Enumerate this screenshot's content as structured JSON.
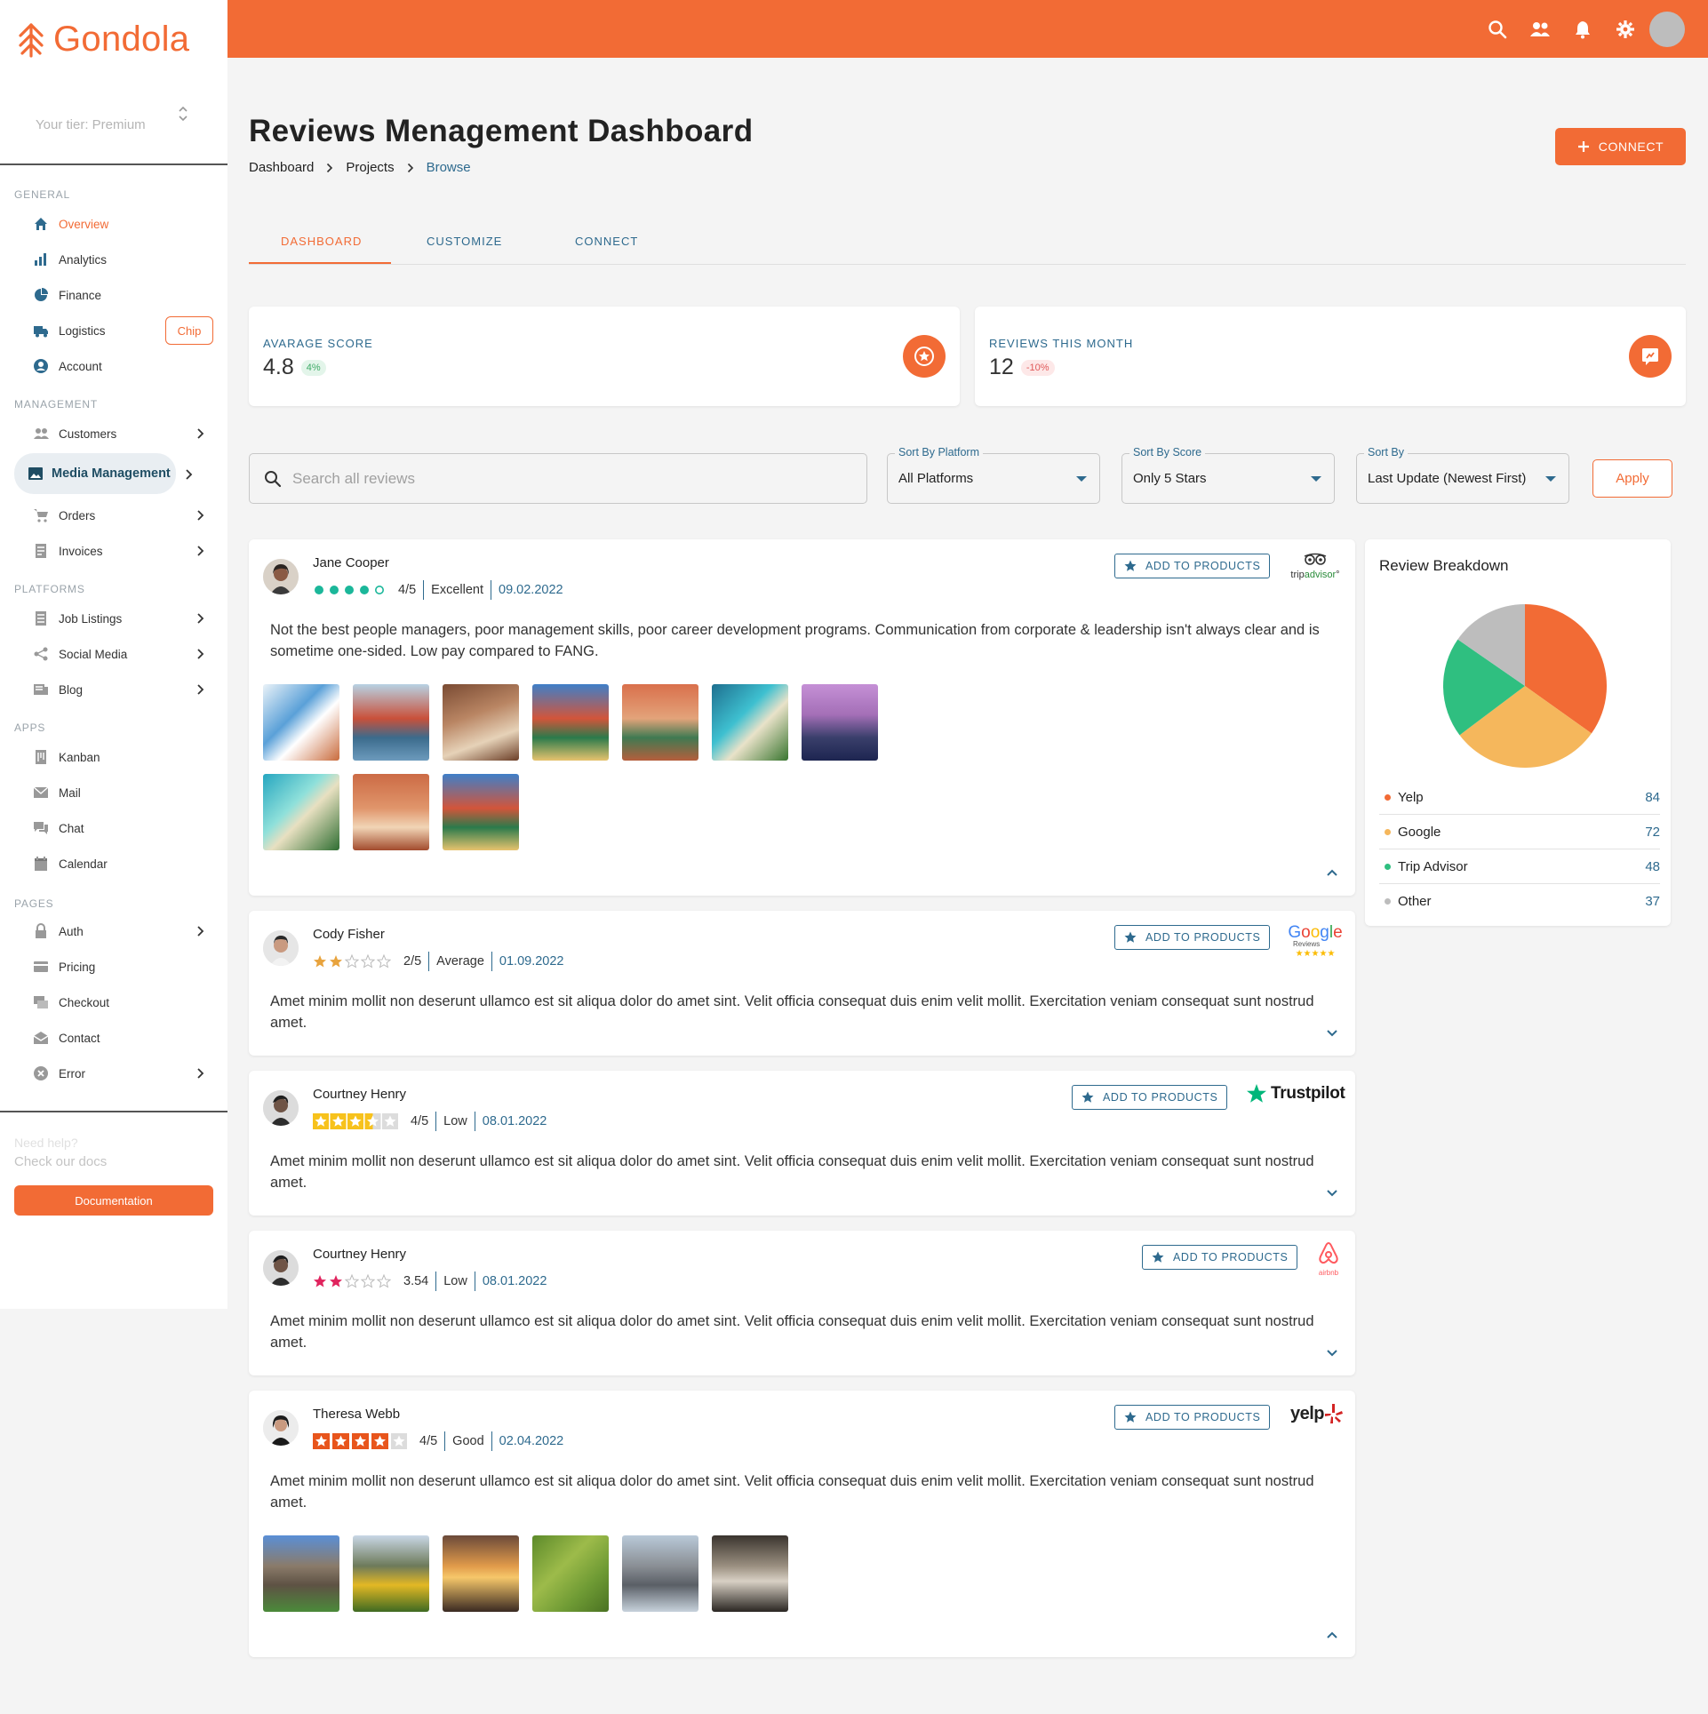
{
  "brand": {
    "name": "Gondola",
    "color": "#f26b35"
  },
  "tier": {
    "text": "Your tier: Premium"
  },
  "sidebar": {
    "sections": [
      "GENERAL",
      "MANAGEMENT",
      "PLATFORMS",
      "APPS",
      "PAGES"
    ],
    "items": [
      {
        "label": "Overview",
        "icon": "home-icon"
      },
      {
        "label": "Analytics",
        "icon": "bar-chart-icon"
      },
      {
        "label": "Finance",
        "icon": "pie-chart-icon"
      },
      {
        "label": "Logistics",
        "icon": "truck-icon",
        "chip": "Chip"
      },
      {
        "label": "Account",
        "icon": "user-circle-icon"
      },
      {
        "label": "Customers",
        "icon": "users-icon"
      },
      {
        "label": "Media Management",
        "icon": "image-icon"
      },
      {
        "label": "Orders",
        "icon": "cart-icon"
      },
      {
        "label": "Invoices",
        "icon": "invoice-icon"
      },
      {
        "label": "Job  Listings",
        "icon": "list-icon"
      },
      {
        "label": "Social  Media",
        "icon": "share-icon"
      },
      {
        "label": "Blog",
        "icon": "blog-icon"
      },
      {
        "label": "Kanban",
        "icon": "kanban-icon"
      },
      {
        "label": "Mail",
        "icon": "mail-icon"
      },
      {
        "label": "Chat",
        "icon": "chat-icon"
      },
      {
        "label": "Calendar",
        "icon": "calendar-icon"
      },
      {
        "label": "Auth",
        "icon": "lock-icon"
      },
      {
        "label": "Pricing",
        "icon": "card-icon"
      },
      {
        "label": "Checkout",
        "icon": "checkout-icon"
      },
      {
        "label": "Contact",
        "icon": "contact-icon"
      },
      {
        "label": "Error",
        "icon": "error-icon"
      }
    ],
    "help": {
      "title": "Need help?",
      "subtitle": "Check our docs",
      "button": "Documentation"
    }
  },
  "header": {
    "title": "Reviews Menagement Dashboard",
    "breadcrumb": [
      "Dashboard",
      "Projects",
      "Browse"
    ],
    "connect_button": "CONNECT"
  },
  "tabs": [
    "DASHBOARD",
    "CUSTOMIZE",
    "CONNECT"
  ],
  "stats": [
    {
      "label": "AVARAGE SCORE",
      "value": "4.8",
      "badge": "4%",
      "trend": "up"
    },
    {
      "label": "REVIEWS THIS MONTH",
      "value": "12",
      "badge": "-10%",
      "trend": "down"
    }
  ],
  "filters": {
    "search_placeholder": "Search all reviews",
    "platform": {
      "label": "Sort By Platform",
      "value": "All Platforms"
    },
    "score": {
      "label": "Sort By Score",
      "value": "Only 5 Stars"
    },
    "sort": {
      "label": "Sort By",
      "value": "Last Update (Newest First)"
    },
    "apply": "Apply"
  },
  "add_to_products": "ADD TO PRODUCTS",
  "reviews": [
    {
      "name": "Jane Cooper",
      "score": "4/5",
      "quality": "Excellent",
      "date": "09.02.2022",
      "platform": "tripadvisor",
      "rating_style": "dots",
      "rating_value": 4,
      "text": "Not the best people managers, poor management skills, poor career development programs. Communication from corporate & leadership isn't always clear and is sometime one-sided. Low pay compared to FANG.",
      "photo_count": 10
    },
    {
      "name": "Cody Fisher",
      "score": "2/5",
      "quality": "Average",
      "date": "01.09.2022",
      "platform": "Google",
      "rating_style": "stars",
      "rating_value": 2,
      "text": "Amet minim mollit non deserunt ullamco est sit aliqua dolor do amet sint. Velit officia consequat duis enim velit mollit. Exercitation veniam consequat sunt nostrud amet.",
      "photo_count": 0
    },
    {
      "name": "Courtney Henry",
      "score": "4/5",
      "quality": "Low",
      "date": "08.01.2022",
      "platform": "Trustpilot",
      "rating_style": "boxes-yellow",
      "rating_value": 3.5,
      "text": "Amet minim mollit non deserunt ullamco est sit aliqua dolor do amet sint. Velit officia consequat duis enim velit mollit. Exercitation veniam consequat sunt nostrud amet.",
      "photo_count": 0
    },
    {
      "name": "Courtney Henry",
      "score": "3.54",
      "quality": "Low",
      "date": "08.01.2022",
      "platform": "airbnb",
      "rating_style": "stars-red",
      "rating_value": 2,
      "text": "Amet minim mollit non deserunt ullamco est sit aliqua dolor do amet sint. Velit officia consequat duis enim velit mollit. Exercitation veniam consequat sunt nostrud amet.",
      "photo_count": 0
    },
    {
      "name": "Theresa Webb",
      "score": "4/5",
      "quality": "Good",
      "date": "02.04.2022",
      "platform": "yelp",
      "rating_style": "boxes-orange",
      "rating_value": 4,
      "text": "Amet minim mollit non deserunt ullamco est sit aliqua dolor do amet sint. Velit officia consequat duis enim velit mollit. Exercitation veniam consequat sunt nostrud amet.",
      "photo_count": 6
    }
  ],
  "breakdown": {
    "title": "Review Breakdown",
    "items": [
      {
        "name": "Yelp",
        "value": 84,
        "color": "#f26b35"
      },
      {
        "name": "Google",
        "value": 72,
        "color": "#f5b75c"
      },
      {
        "name": "Trip Advisor",
        "value": 48,
        "color": "#2fbf80"
      },
      {
        "name": "Other",
        "value": 37,
        "color": "#bdbdbd"
      }
    ]
  },
  "colors": {
    "accent": "#f26b35",
    "primary_text": "#2e6a8e",
    "teal": "#1bb79a"
  }
}
